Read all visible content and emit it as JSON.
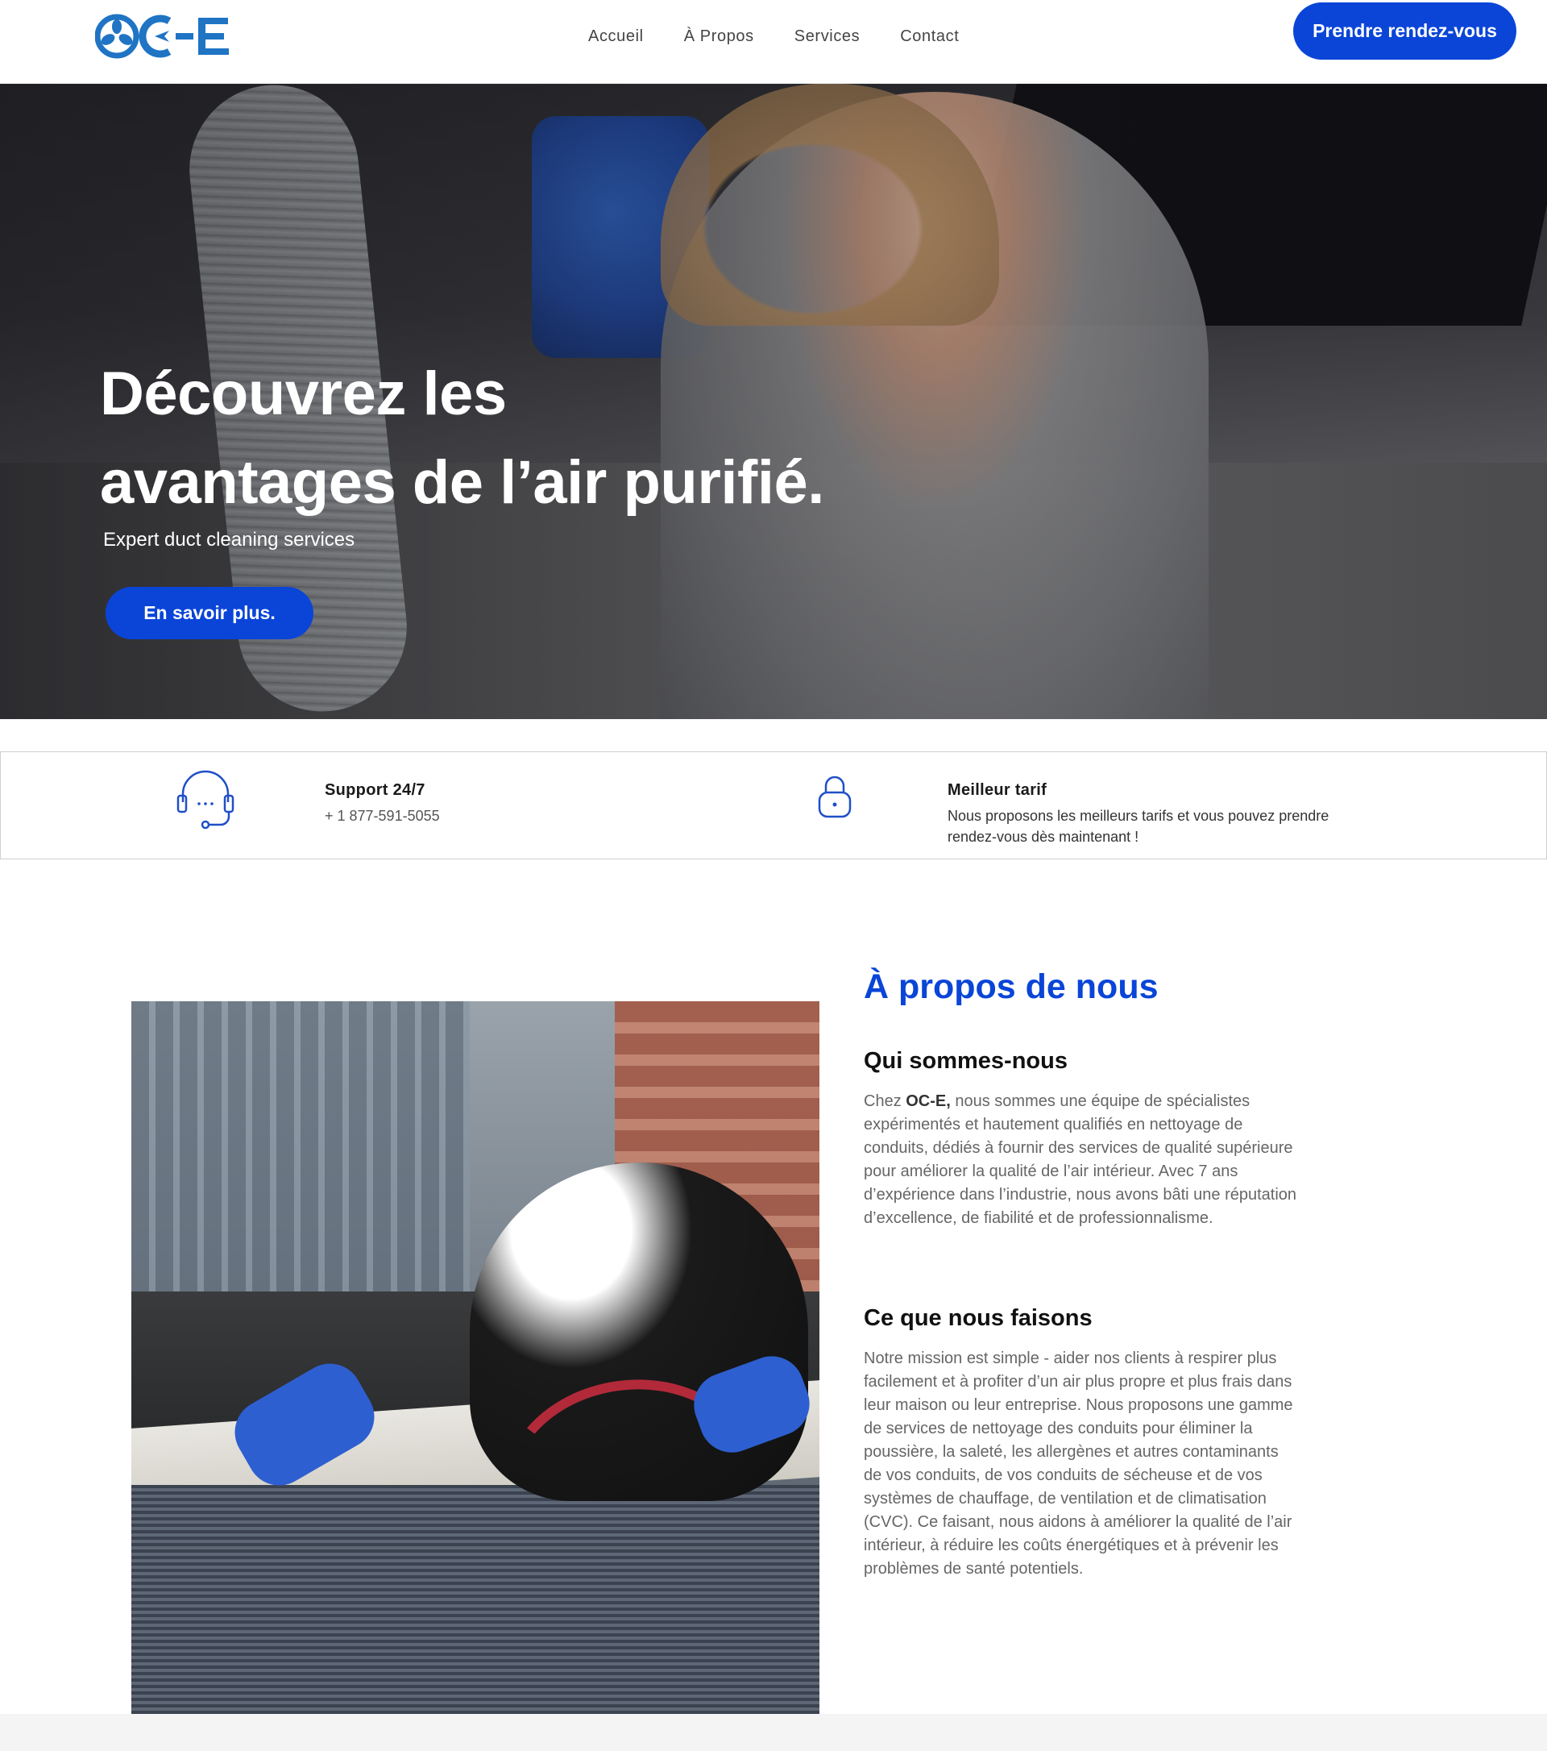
{
  "brand": {
    "logo_text": "OC-E",
    "accent_color": "#0a45d8",
    "logo_color": "#1f74c4"
  },
  "nav": {
    "items": [
      {
        "label": "Accueil"
      },
      {
        "label": "À Propos"
      },
      {
        "label": "Services"
      },
      {
        "label": "Contact"
      }
    ],
    "cta_label": "Prendre rendez-vous"
  },
  "hero": {
    "title_line1": "Découvrez les",
    "title_line2": "avantages de l’air purifié.",
    "subtitle": "Expert duct cleaning services",
    "button_label": "En savoir plus."
  },
  "features": [
    {
      "icon": "headset-icon",
      "title": "Support 24/7",
      "text": "+ 1 877-591-5055"
    },
    {
      "icon": "lock-icon",
      "title": "Meilleur tarif",
      "text_line1": "Nous proposons les meilleurs tarifs et vous pouvez prendre",
      "text_line2": "rendez-vous dès maintenant !"
    }
  ],
  "about": {
    "heading": "À propos de nous",
    "who_title": "Qui sommes-nous",
    "who_text_prefix": "Chez ",
    "who_text_brand": "OC-E,",
    "who_text_body": " nous sommes une équipe de spécialistes expérimentés et hautement qualifiés en nettoyage de conduits, dédiés à fournir des services de qualité supérieure pour améliorer la qualité de l’air intérieur. Avec 7 ans d’expérience dans l’industrie, nous avons bâti une réputation d’excellence, de fiabilité et de professionnalisme.",
    "what_title": "Ce que nous faisons",
    "what_text": "Notre mission est simple - aider nos clients à respirer plus facilement et à profiter d’un air plus propre et plus frais dans leur maison ou leur entreprise. Nous proposons une gamme de services de nettoyage des conduits pour éliminer la poussière, la saleté, les allergènes et autres contaminants de vos conduits, de vos conduits de sécheuse et de vos systèmes de chauffage, de ventilation et de climatisation (CVC). Ce faisant, nous aidons à améliorer la qualité de l’air intérieur, à réduire les coûts énergétiques et à prévenir les problèmes de santé potentiels."
  }
}
